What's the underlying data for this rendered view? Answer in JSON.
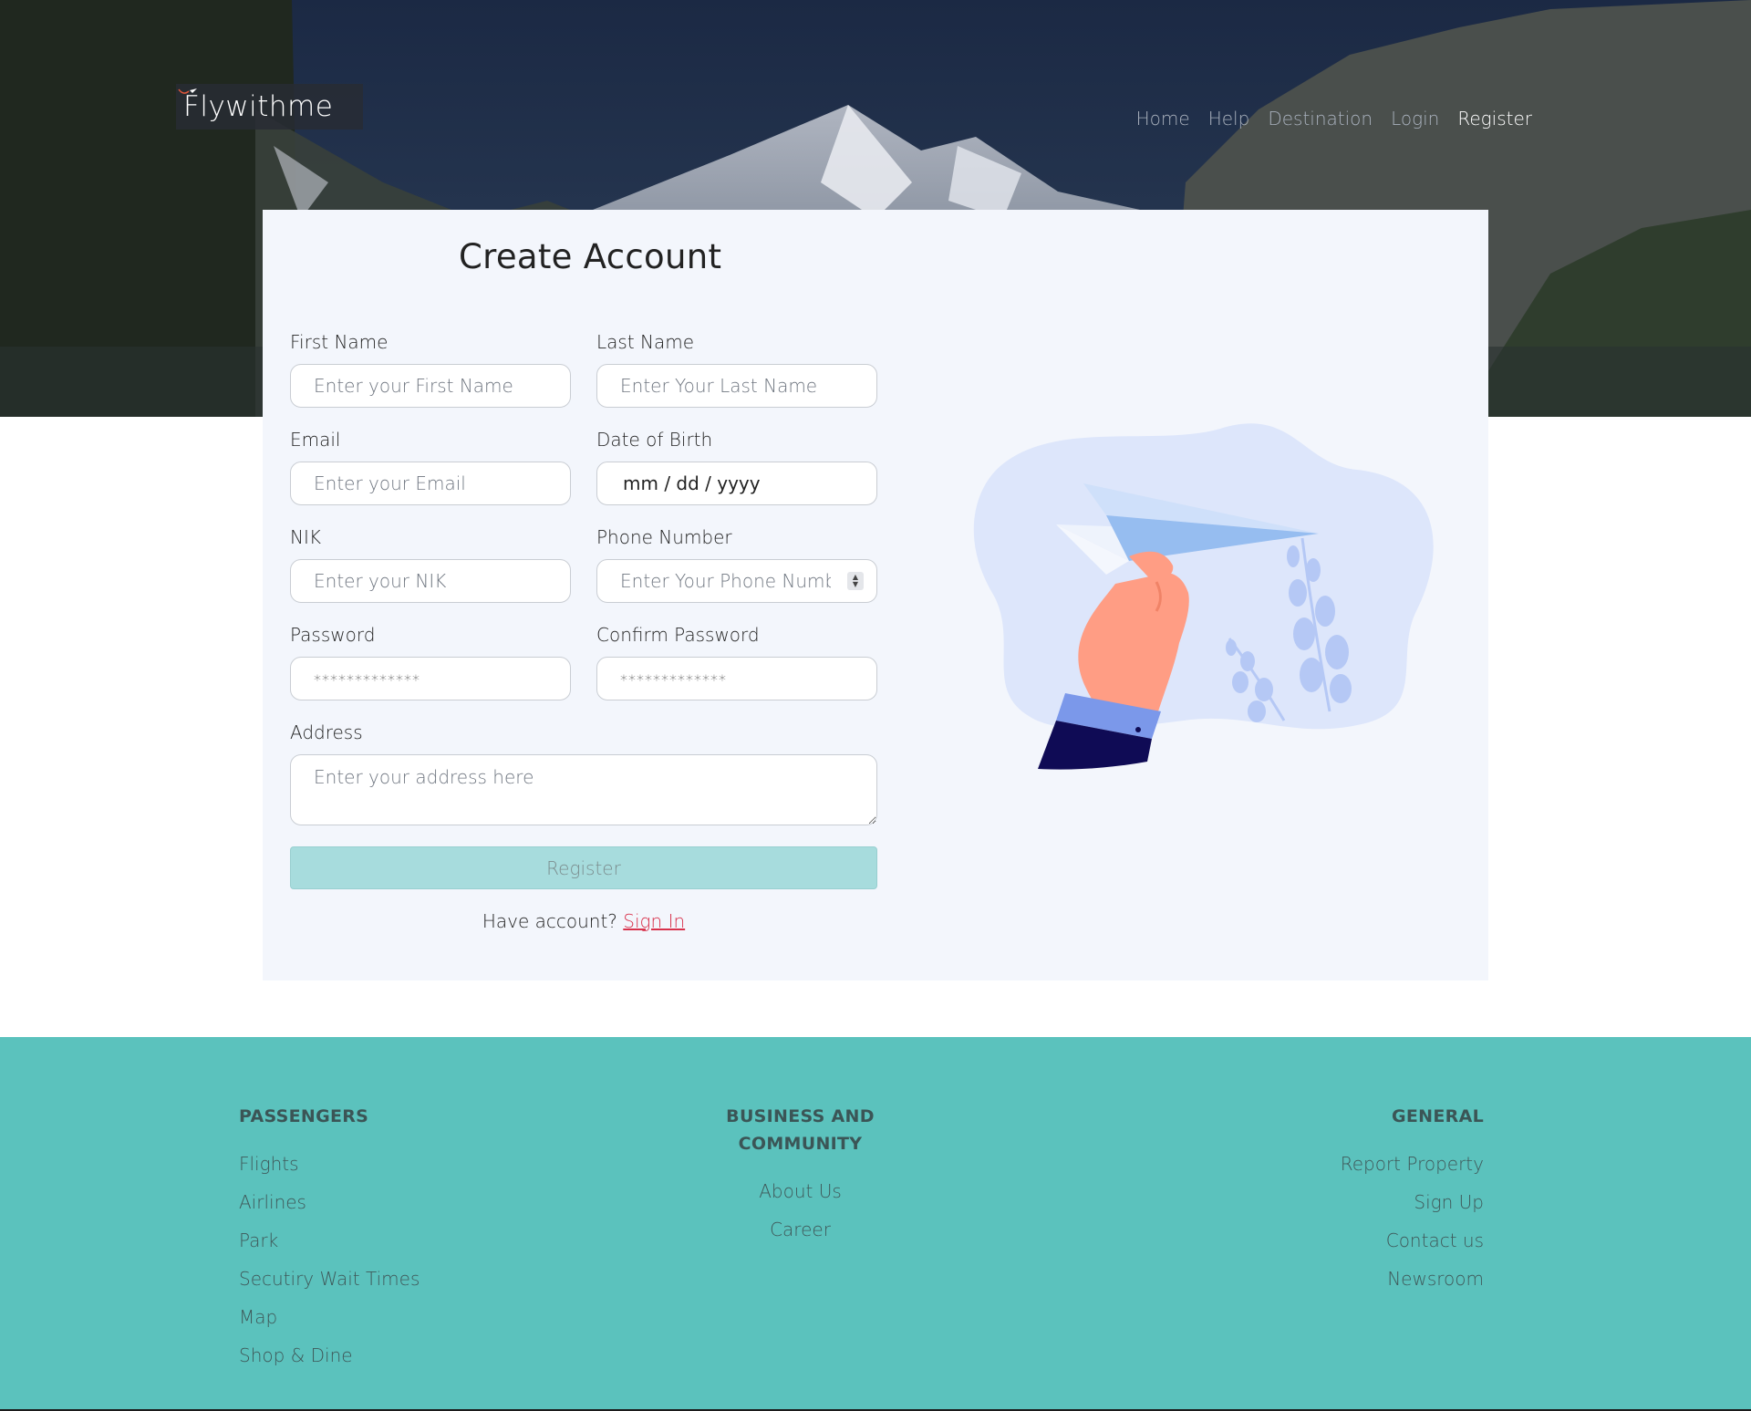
{
  "brand": {
    "logo_text": "Flywithme"
  },
  "nav": {
    "items": [
      {
        "label": "Home",
        "active": false
      },
      {
        "label": "Help",
        "active": false
      },
      {
        "label": "Destination",
        "active": false
      },
      {
        "label": "Login",
        "active": false
      },
      {
        "label": "Register",
        "active": true
      }
    ]
  },
  "form": {
    "title": "Create Account",
    "first_name": {
      "label": "First Name",
      "placeholder": "Enter your First Name"
    },
    "last_name": {
      "label": "Last Name",
      "placeholder": "Enter Your Last Name"
    },
    "email": {
      "label": "Email",
      "placeholder": "Enter your Email"
    },
    "dob": {
      "label": "Date of Birth",
      "value": "mm / dd / yyyy"
    },
    "nik": {
      "label": "NIK",
      "placeholder": "Enter your NIK"
    },
    "phone": {
      "label": "Phone Number",
      "placeholder": "Enter Your Phone Number"
    },
    "password": {
      "label": "Password",
      "placeholder": "*************"
    },
    "confirm_password": {
      "label": "Confirm Password",
      "placeholder": "*************"
    },
    "address": {
      "label": "Address",
      "placeholder": "Enter your address here"
    },
    "submit_label": "Register",
    "have_account_text": "Have account?",
    "sign_in_link": "Sign In"
  },
  "footer": {
    "passengers": {
      "title": "PASSENGERS",
      "links": [
        "Flights",
        "Airlines",
        "Park",
        "Secutiry Wait Times",
        "Map",
        "Shop & Dine"
      ]
    },
    "business": {
      "title": "BUSINESS AND COMMUNITY",
      "links": [
        "About Us",
        "Career"
      ]
    },
    "general": {
      "title": "GENERAL",
      "links": [
        "Report Property",
        "Sign Up",
        "Contact us",
        "Newsroom"
      ]
    }
  },
  "colors": {
    "footer_bg": "#5bc2bd",
    "card_bg": "#f3f6fc",
    "button_bg": "#a7dcdd",
    "link_accent": "#d8324c"
  }
}
